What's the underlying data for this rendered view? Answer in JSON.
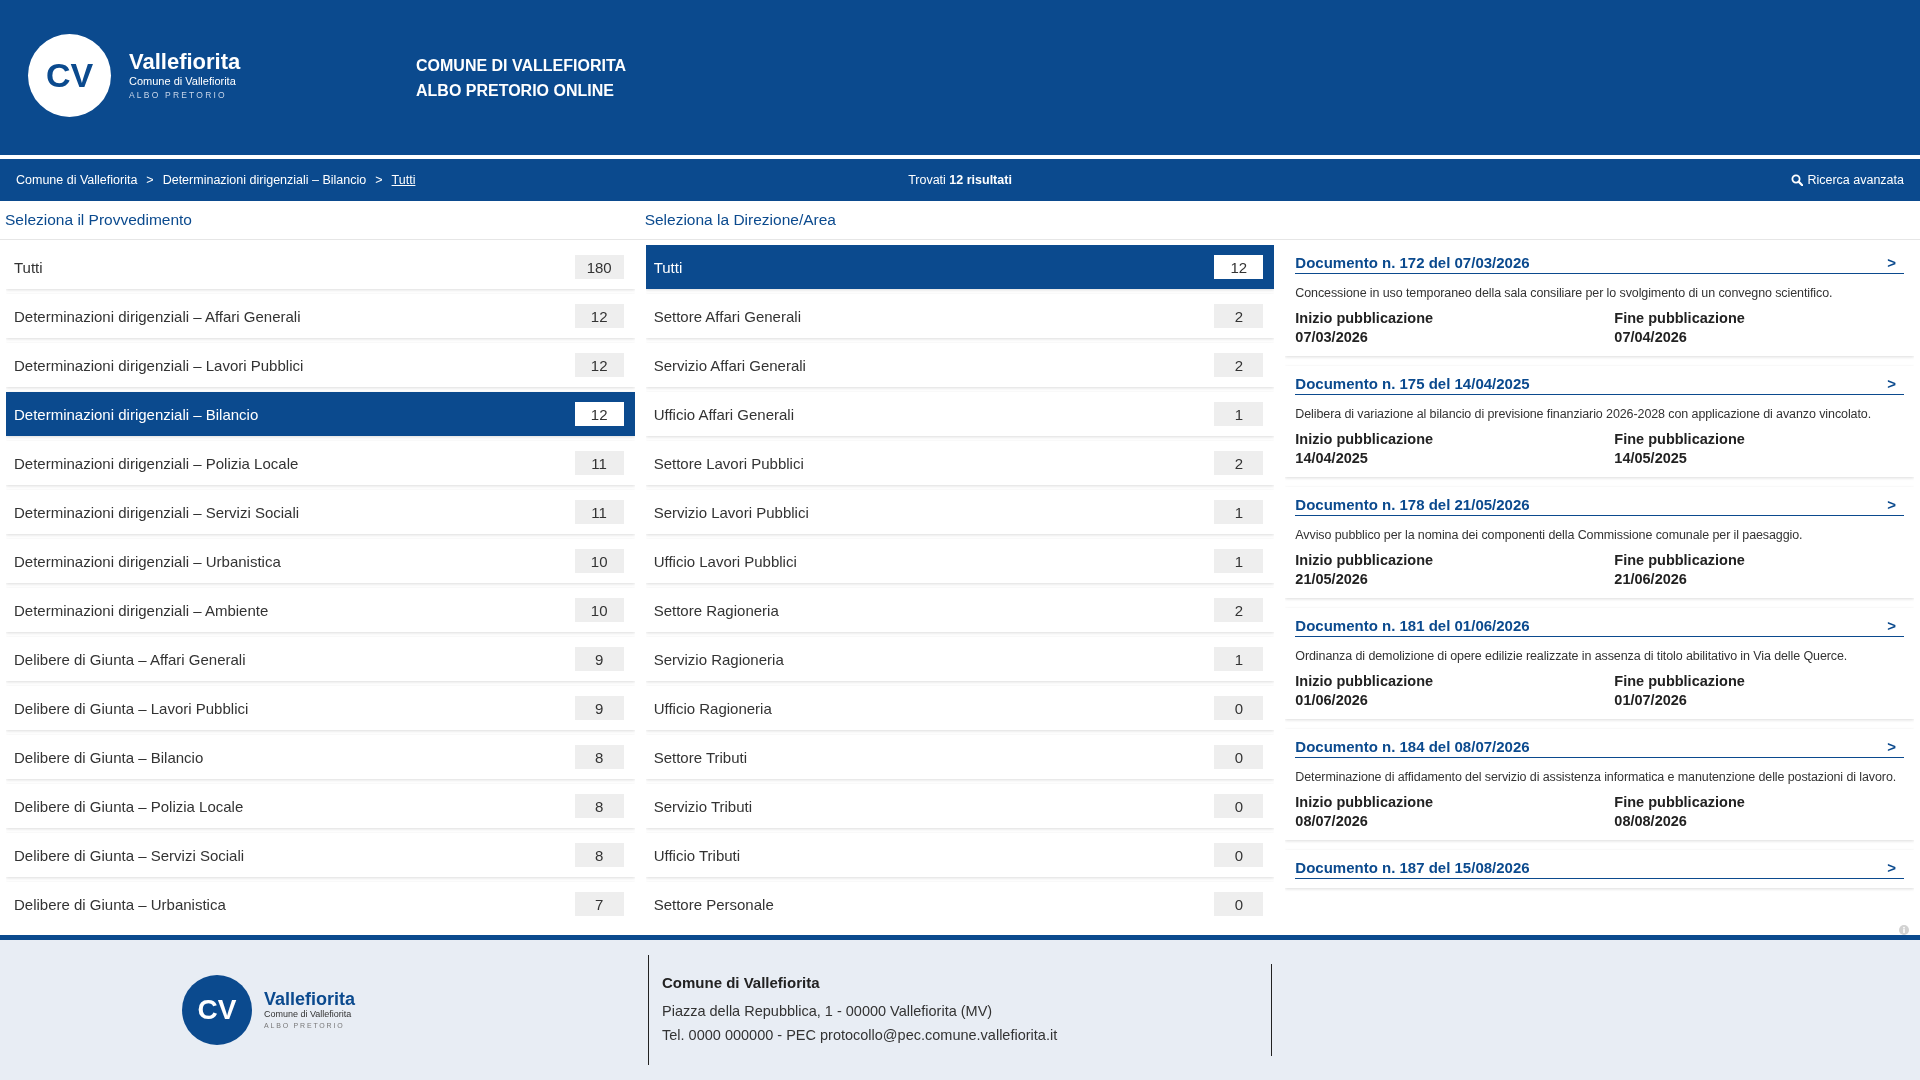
{
  "header": {
    "logo": {
      "monogram": "CV",
      "name": "Vallefiorita",
      "subtitle": "Comune di Vallefiorita",
      "tagline": "ALBO PRETORIO"
    },
    "title_lines": [
      "COMUNE DI VALLEFIORITA",
      "ALBO PRETORIO ONLINE"
    ]
  },
  "breadcrumb": {
    "items": [
      {
        "label": "Comune di Vallefiorita",
        "current": false,
        "separator": ">"
      },
      {
        "label": "Determinazioni dirigenziali – Bilancio",
        "current": false,
        "separator": ">"
      },
      {
        "label": "Tutti",
        "current": true
      }
    ],
    "results": "Trovati **12 risultati**",
    "advanced_search": "Ricerca avanzata"
  },
  "provvedimento": {
    "heading": "Seleziona il Provvedimento",
    "items": [
      {
        "label": "Tutti",
        "count": "180",
        "selected": false
      },
      {
        "label": "Determinazioni dirigenziali – Affari Generali",
        "count": "12",
        "selected": false
      },
      {
        "label": "Determinazioni dirigenziali – Lavori Pubblici",
        "count": "12",
        "selected": false
      },
      {
        "label": "Determinazioni dirigenziali – Bilancio",
        "count": "12",
        "selected": true
      },
      {
        "label": "Determinazioni dirigenziali – Polizia Locale",
        "count": "11",
        "selected": false
      },
      {
        "label": "Determinazioni dirigenziali – Servizi Sociali",
        "count": "11",
        "selected": false
      },
      {
        "label": "Determinazioni dirigenziali – Urbanistica",
        "count": "10",
        "selected": false
      },
      {
        "label": "Determinazioni dirigenziali – Ambiente",
        "count": "10",
        "selected": false
      },
      {
        "label": "Delibere di Giunta – Affari Generali",
        "count": "9",
        "selected": false
      },
      {
        "label": "Delibere di Giunta – Lavori Pubblici",
        "count": "9",
        "selected": false
      },
      {
        "label": "Delibere di Giunta – Bilancio",
        "count": "8",
        "selected": false
      },
      {
        "label": "Delibere di Giunta – Polizia Locale",
        "count": "8",
        "selected": false
      },
      {
        "label": "Delibere di Giunta – Servizi Sociali",
        "count": "8",
        "selected": false
      },
      {
        "label": "Delibere di Giunta – Urbanistica",
        "count": "7",
        "selected": false
      }
    ]
  },
  "direzione": {
    "heading": "Seleziona la Direzione/Area",
    "items": [
      {
        "label": "Tutti",
        "count": "12",
        "selected": true
      },
      {
        "label": "Settore Affari Generali",
        "count": "2",
        "selected": false
      },
      {
        "label": "Servizio Affari Generali",
        "count": "2",
        "selected": false
      },
      {
        "label": "Ufficio Affari Generali",
        "count": "1",
        "selected": false
      },
      {
        "label": "Settore Lavori Pubblici",
        "count": "2",
        "selected": false
      },
      {
        "label": "Servizio Lavori Pubblici",
        "count": "1",
        "selected": false
      },
      {
        "label": "Ufficio Lavori Pubblici",
        "count": "1",
        "selected": false
      },
      {
        "label": "Settore Ragioneria",
        "count": "2",
        "selected": false
      },
      {
        "label": "Servizio Ragioneria",
        "count": "1",
        "selected": false
      },
      {
        "label": "Ufficio Ragioneria",
        "count": "0",
        "selected": false
      },
      {
        "label": "Settore Tributi",
        "count": "0",
        "selected": false
      },
      {
        "label": "Servizio Tributi",
        "count": "0",
        "selected": false
      },
      {
        "label": "Ufficio Tributi",
        "count": "0",
        "selected": false
      },
      {
        "label": "Settore Personale",
        "count": "0",
        "selected": false
      }
    ]
  },
  "documents": [
    {
      "title": "Documento n. 172 del 07/03/2026",
      "arrow": ">",
      "description": "Concessione in uso temporaneo della sala consiliare per lo svolgimento di un convegno scientifico.",
      "start_label": "Inizio pubblicazione",
      "start_date": "07/03/2026",
      "end_label": "Fine pubblicazione",
      "end_date": "07/04/2026"
    },
    {
      "title": "Documento n. 175 del 14/04/2025",
      "arrow": ">",
      "description": "Delibera di variazione al bilancio di previsione finanziario 2026-2028 con applicazione di avanzo vincolato.",
      "start_label": "Inizio pubblicazione",
      "start_date": "14/04/2025",
      "end_label": "Fine pubblicazione",
      "end_date": "14/05/2025"
    },
    {
      "title": "Documento n. 178 del 21/05/2026",
      "arrow": ">",
      "description": "Avviso pubblico per la nomina dei componenti della Commissione comunale per il paesaggio.",
      "start_label": "Inizio pubblicazione",
      "start_date": "21/05/2026",
      "end_label": "Fine pubblicazione",
      "end_date": "21/06/2026"
    },
    {
      "title": "Documento n. 181 del 01/06/2026",
      "arrow": ">",
      "description": "Ordinanza di demolizione di opere edilizie realizzate in assenza di titolo abilitativo in Via delle Querce.",
      "start_label": "Inizio pubblicazione",
      "start_date": "01/06/2026",
      "end_label": "Fine pubblicazione",
      "end_date": "01/07/2026"
    },
    {
      "title": "Documento n. 184 del 08/07/2026",
      "arrow": ">",
      "description": "Determinazione di affidamento del servizio di assistenza informatica e manutenzione delle postazioni di lavoro.",
      "start_label": "Inizio pubblicazione",
      "start_date": "08/07/2026",
      "end_label": "Fine pubblicazione",
      "end_date": "08/08/2026"
    },
    {
      "title": "Documento n. 187 del 15/08/2026",
      "arrow": ">"
    }
  ],
  "footer": {
    "logo": {
      "monogram": "CV",
      "name": "Vallefiorita",
      "subtitle": "Comune di Vallefiorita",
      "tagline": "ALBO PRETORIO"
    },
    "name": "Comune di Vallefiorita",
    "address": "Piazza della Repubblica, 1 - 00000 Vallefiorita (MV)",
    "contacts": "Tel. 0000 000000 - PEC protocollo@pec.comune.vallefiorita.it"
  }
}
